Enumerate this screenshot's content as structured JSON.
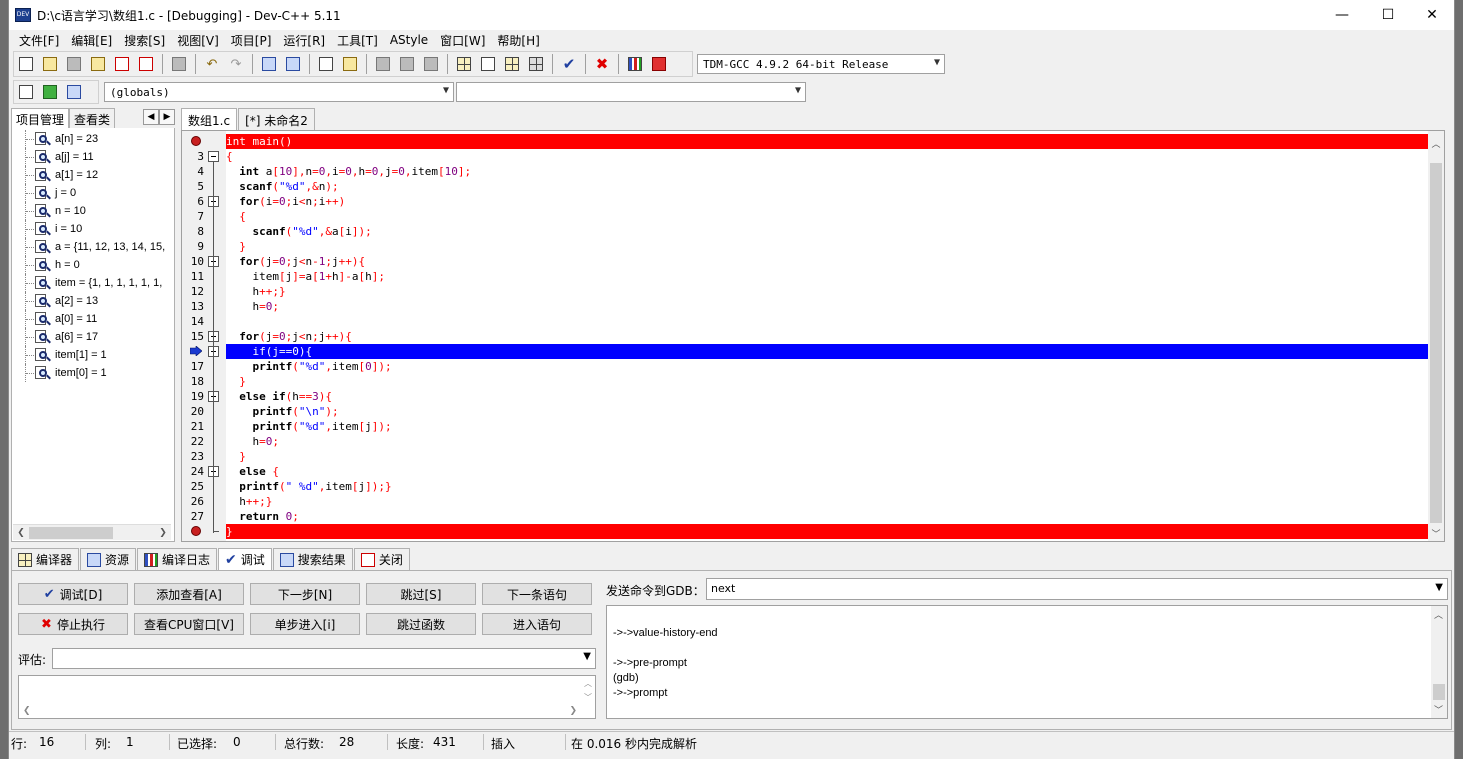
{
  "window": {
    "title": "D:\\c语言学习\\数组1.c - [Debugging] - Dev-C++ 5.11",
    "app_icon_text": "DEV",
    "minimize": "—",
    "maximize": "☐",
    "close": "✕"
  },
  "menu": [
    "文件[F]",
    "编辑[E]",
    "搜索[S]",
    "视图[V]",
    "项目[P]",
    "运行[R]",
    "工具[T]",
    "AStyle",
    "窗口[W]",
    "帮助[H]"
  ],
  "toolbar": {
    "compiler_select": "TDM-GCC 4.9.2 64-bit Release",
    "scope_select": "(globals)",
    "function_select": ""
  },
  "left_panel": {
    "tabs": [
      "项目管理",
      "查看类"
    ],
    "watches": [
      "a[n] = 23",
      "a[j] = 11",
      "a[1] = 12",
      "j = 0",
      "n = 10",
      "i = 10",
      "a = {11, 12, 13, 14, 15,",
      "h = 0",
      "item = {1, 1, 1, 1, 1, 1,",
      "a[2] = 13",
      "a[0] = 11",
      "a[6] = 17",
      "item[1] = 1",
      "item[0] = 1"
    ]
  },
  "editor": {
    "tabs": [
      "数组1.c",
      "[*] 未命名2"
    ],
    "lines": [
      {
        "n": "",
        "text": "int main()"
      },
      {
        "n": "3",
        "text": "{"
      },
      {
        "n": "4",
        "text": "  int a[10],n=0,i=0,h=0,j=0,item[10];"
      },
      {
        "n": "5",
        "text": "  scanf(\"%d\",&n);"
      },
      {
        "n": "6",
        "text": "  for(i=0;i<n;i++)"
      },
      {
        "n": "7",
        "text": "  {"
      },
      {
        "n": "8",
        "text": "    scanf(\"%d\",&a[i]);"
      },
      {
        "n": "9",
        "text": "  }"
      },
      {
        "n": "10",
        "text": "  for(j=0;j<n-1;j++){"
      },
      {
        "n": "11",
        "text": "    item[j]=a[1+h]-a[h];"
      },
      {
        "n": "12",
        "text": "    h++;}"
      },
      {
        "n": "13",
        "text": "    h=0;"
      },
      {
        "n": "14",
        "text": ""
      },
      {
        "n": "15",
        "text": "  for(j=0;j<n;j++){"
      },
      {
        "n": "",
        "text": "    if(j==0){"
      },
      {
        "n": "17",
        "text": "    printf(\"%d\",item[0]);"
      },
      {
        "n": "18",
        "text": "  }"
      },
      {
        "n": "19",
        "text": "  else if(h==3){"
      },
      {
        "n": "20",
        "text": "    printf(\"\\n\");"
      },
      {
        "n": "21",
        "text": "    printf(\"%d\",item[j]);"
      },
      {
        "n": "22",
        "text": "    h=0;"
      },
      {
        "n": "23",
        "text": "  }"
      },
      {
        "n": "24",
        "text": "  else {"
      },
      {
        "n": "25",
        "text": "  printf(\" %d\",item[j]);}"
      },
      {
        "n": "26",
        "text": "  h++;}"
      },
      {
        "n": "27",
        "text": "  return 0;"
      },
      {
        "n": "",
        "text": "}"
      }
    ]
  },
  "bottom_tabs": [
    "编译器",
    "资源",
    "编译日志",
    "调试",
    "搜索结果",
    "关闭"
  ],
  "debug": {
    "buttons_row1": [
      "调试[D]",
      "添加查看[A]",
      "下一步[N]",
      "跳过[S]",
      "下一条语句"
    ],
    "buttons_row2": [
      "停止执行",
      "查看CPU窗口[V]",
      "单步进入[i]",
      "跳过函数",
      "进入语句"
    ],
    "eval_label": "评估:",
    "gdb_label": "发送命令到GDB：",
    "gdb_command": "next",
    "gdb_output": [
      "",
      "->->value-history-end",
      "",
      "->->pre-prompt",
      "(gdb)",
      "->->prompt"
    ]
  },
  "status": {
    "row_label": "行:",
    "row": "16",
    "col_label": "列:",
    "col": "1",
    "sel_label": "已选择:",
    "sel": "0",
    "lines_label": "总行数:",
    "lines": "28",
    "len_label": "长度:",
    "len": "431",
    "mode": "插入",
    "parse": "在 0.016 秒内完成解析"
  },
  "colors": {
    "breakpoint_line": "#ff0000",
    "current_line": "#0000ff"
  }
}
